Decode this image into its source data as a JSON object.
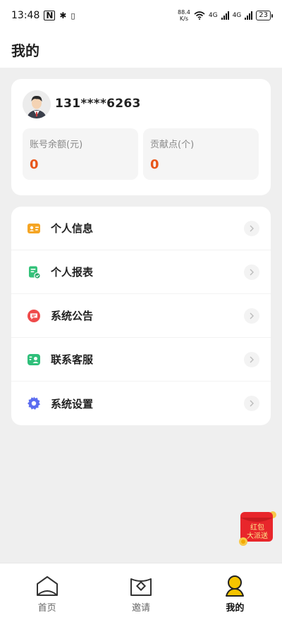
{
  "status_bar": {
    "time": "13:48",
    "netspeed_value": "88.4",
    "netspeed_unit": "K/s",
    "net1": "4G",
    "net2": "4G",
    "battery": "23"
  },
  "header": {
    "title": "我的"
  },
  "profile": {
    "username": "131****6263",
    "stats": [
      {
        "label": "账号余额(元)",
        "value": "0"
      },
      {
        "label": "贡献点(个)",
        "value": "0"
      }
    ]
  },
  "menu": [
    {
      "label": "个人信息",
      "icon": "id-card-icon",
      "color": "#f5a524"
    },
    {
      "label": "个人报表",
      "icon": "report-icon",
      "color": "#34c27a"
    },
    {
      "label": "系统公告",
      "icon": "announcement-icon",
      "color": "#ef4b4b"
    },
    {
      "label": "联系客服",
      "icon": "customer-service-icon",
      "color": "#2fbf7a"
    },
    {
      "label": "系统设置",
      "icon": "settings-icon",
      "color": "#5b6cf0"
    }
  ],
  "red_envelope": {
    "line1": "红包",
    "line2": "大派送"
  },
  "tabbar": {
    "tabs": [
      {
        "label": "首页"
      },
      {
        "label": "邀请"
      },
      {
        "label": "我的"
      }
    ],
    "active": 2
  },
  "colors": {
    "accent_value": "#e8561a",
    "active_tab": "#f5c400"
  }
}
